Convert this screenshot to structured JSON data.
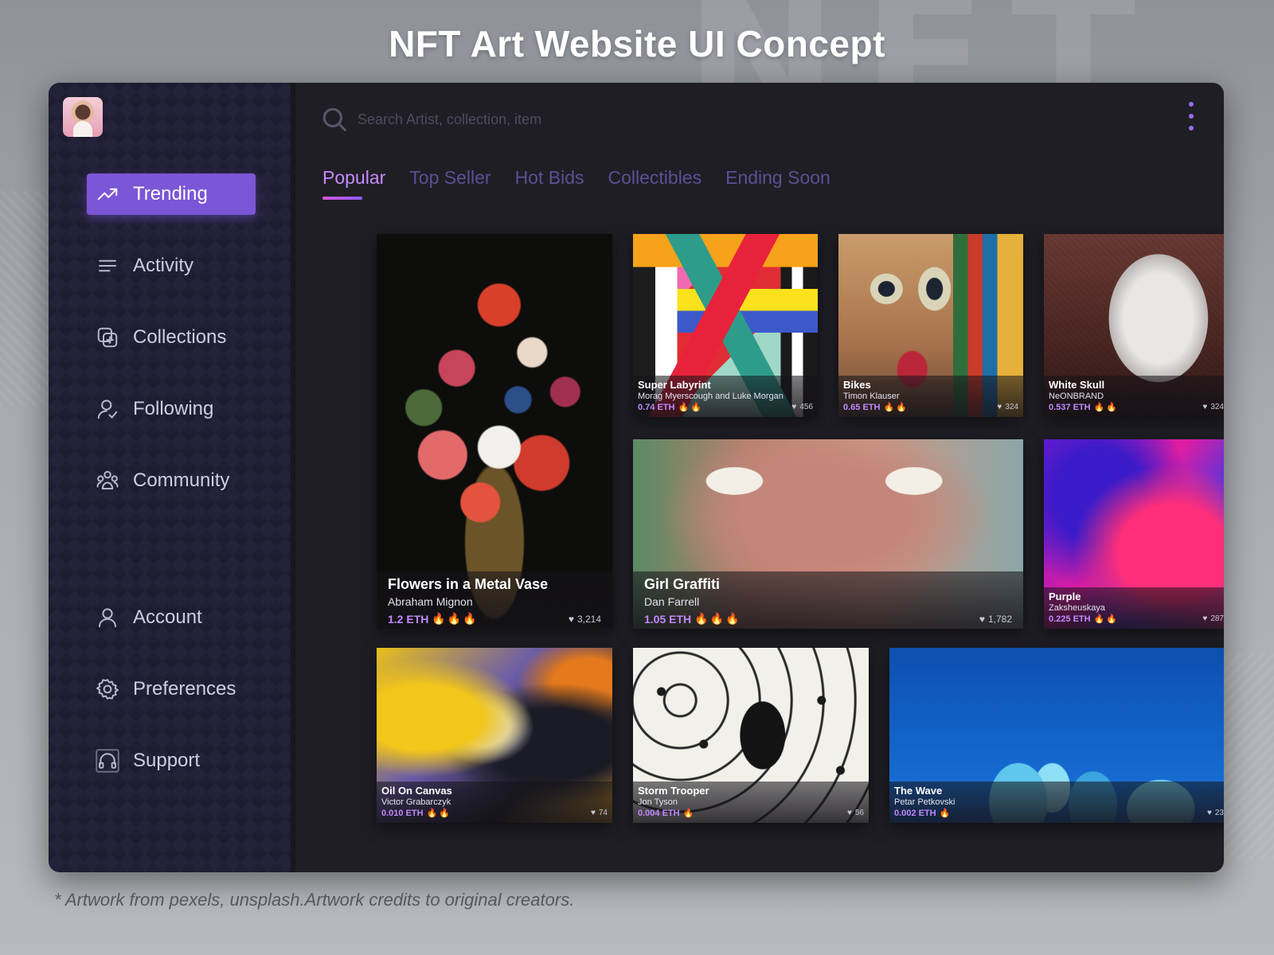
{
  "page": {
    "headline": "NFT Art Website UI Concept",
    "watermark": "NFT",
    "footnote": "* Artwork from pexels, unsplash.Artwork credits to original creators."
  },
  "sidebar": {
    "items": [
      {
        "label": "Trending",
        "icon": "trending-up-icon",
        "active": true
      },
      {
        "label": "Activity",
        "icon": "lines-icon",
        "active": false
      },
      {
        "label": "Collections",
        "icon": "collections-add-icon",
        "active": false
      },
      {
        "label": "Following",
        "icon": "user-check-icon",
        "active": false
      },
      {
        "label": "Community",
        "icon": "community-icon",
        "active": false
      },
      {
        "label": "Account",
        "icon": "user-icon",
        "active": false
      },
      {
        "label": "Preferences",
        "icon": "gear-icon",
        "active": false
      },
      {
        "label": "Support",
        "icon": "headset-icon",
        "active": false
      }
    ]
  },
  "search": {
    "placeholder": "Search Artist, collection, item"
  },
  "tabs": [
    {
      "label": "Popular",
      "active": true
    },
    {
      "label": "Top Seller",
      "active": false
    },
    {
      "label": "Hot Bids",
      "active": false
    },
    {
      "label": "Collectibles",
      "active": false
    },
    {
      "label": "Ending Soon",
      "active": false
    }
  ],
  "cards": [
    {
      "title": "Flowers in a Metal Vase",
      "artist": "Abraham Mignon",
      "price": "1.2 ETH",
      "flames": "🔥🔥🔥",
      "likes": "3,214"
    },
    {
      "title": "Super Labyrint",
      "artist": "Morag Myerscough and Luke Morgan",
      "price": "0.74 ETH",
      "flames": "🔥🔥",
      "likes": "456"
    },
    {
      "title": "Bikes",
      "artist": "Timon Klauser",
      "price": "0.65 ETH",
      "flames": "🔥🔥",
      "likes": "324"
    },
    {
      "title": "White Skull",
      "artist": "NeONBRAND",
      "price": "0.537 ETH",
      "flames": "🔥🔥",
      "likes": "324"
    },
    {
      "title": "Girl Graffiti",
      "artist": "Dan Farrell",
      "price": "1.05 ETH",
      "flames": "🔥🔥🔥",
      "likes": "1,782"
    },
    {
      "title": "Purple",
      "artist": "Zaksheuskaya",
      "price": "0.225 ETH",
      "flames": "🔥🔥",
      "likes": "287"
    },
    {
      "title": "Oil On Canvas",
      "artist": "Victor Grabarczyk",
      "price": "0.010 ETH",
      "flames": "🔥🔥",
      "likes": "74"
    },
    {
      "title": "Storm Trooper",
      "artist": "Jon Tyson",
      "price": "0.004 ETH",
      "flames": "🔥",
      "likes": "56"
    },
    {
      "title": "The Wave",
      "artist": "Petar Petkovski",
      "price": "0.002 ETH",
      "flames": "🔥",
      "likes": "23"
    }
  ],
  "colors": {
    "accent": "#7b56d6",
    "tab_active": "#c68cff",
    "price": "#c189ff",
    "app_bg": "#1f1e25"
  }
}
